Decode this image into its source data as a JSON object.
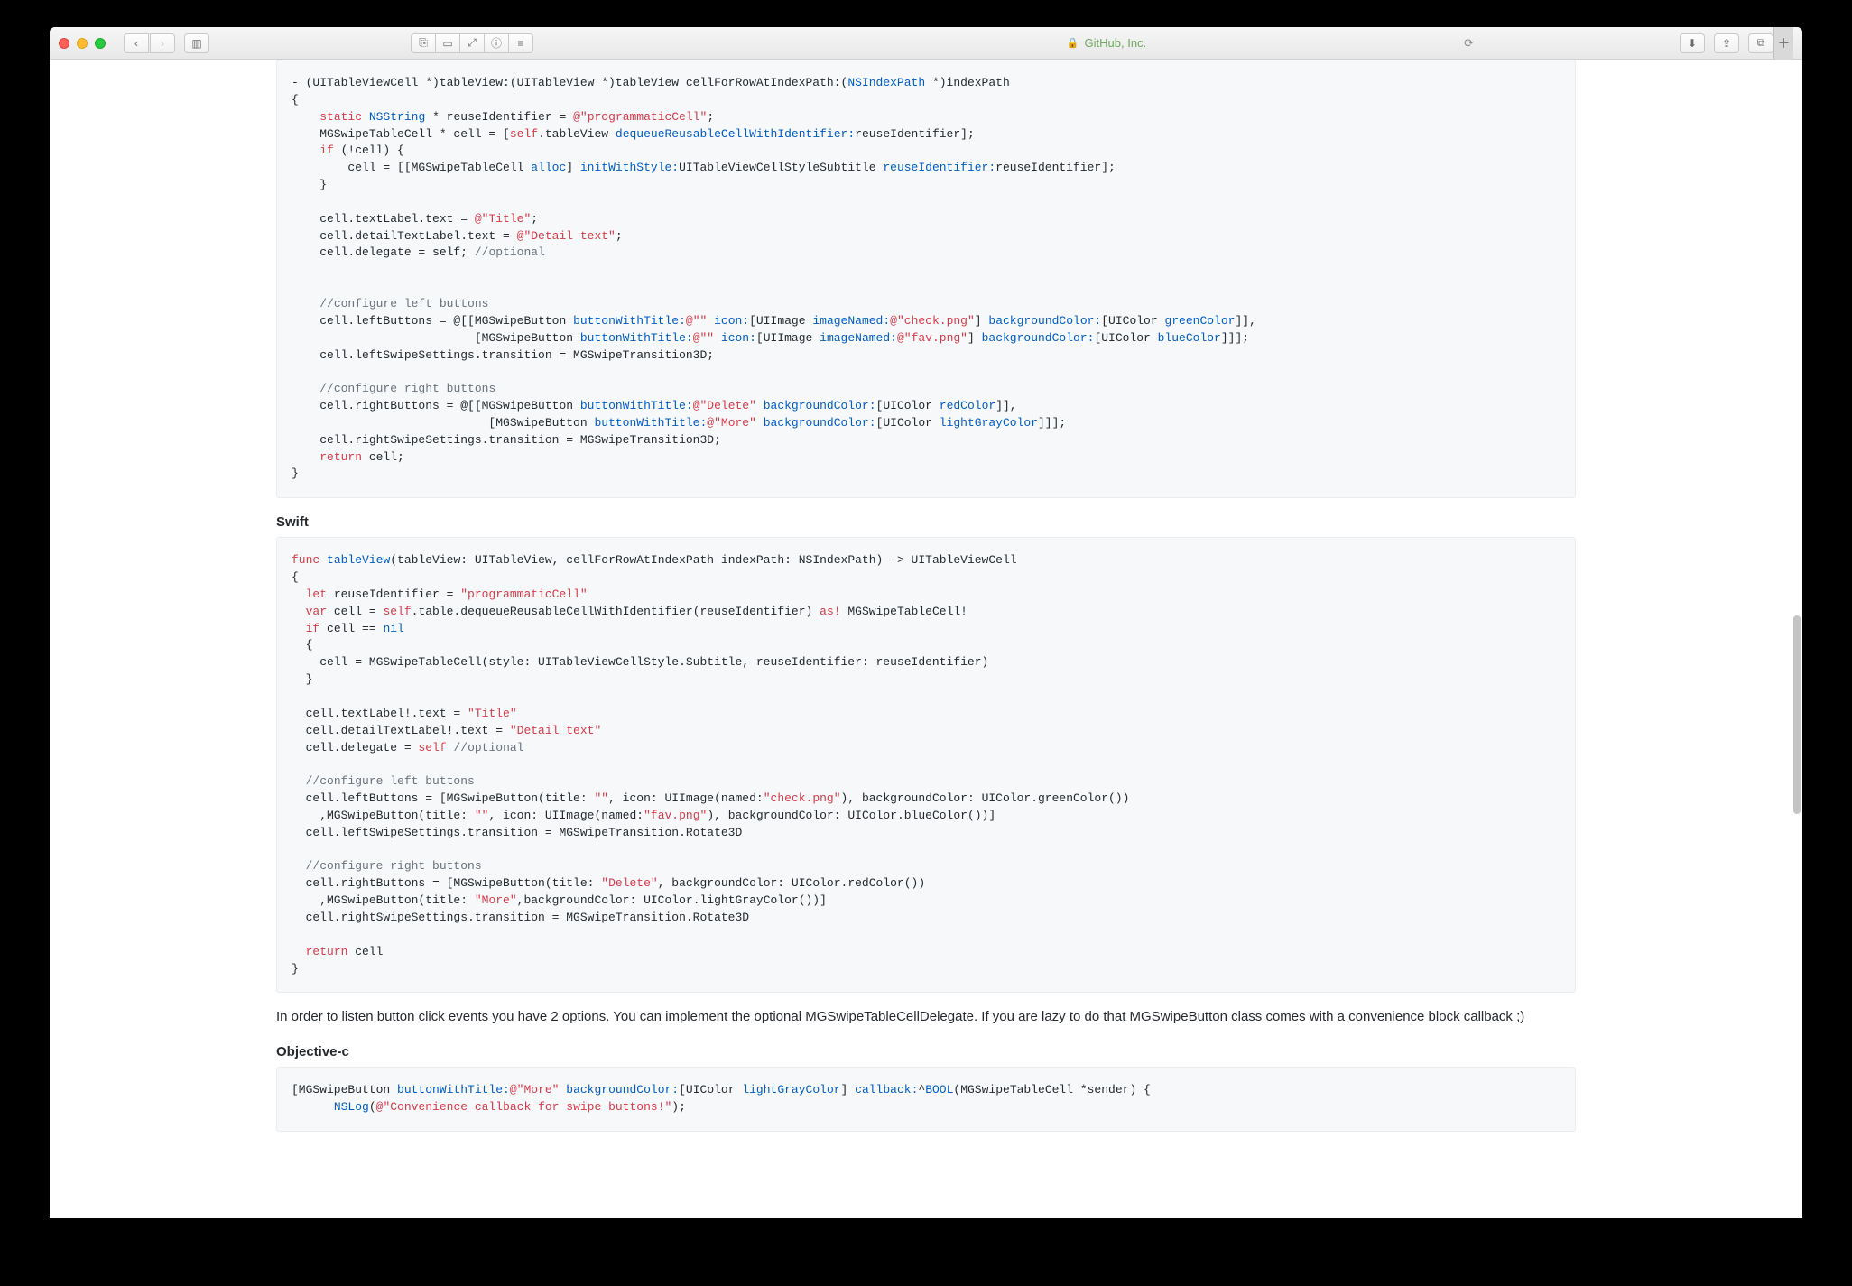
{
  "browser": {
    "address_host": "GitHub, Inc.",
    "reload_glyph": "⟳",
    "back_glyph": "‹",
    "forward_glyph": "›",
    "sidebar_glyph": "▥",
    "reader_glyph": "⎘",
    "layout_glyph": "▭",
    "fullscreen_glyph": "⤢",
    "info_glyph": "ⓘ",
    "list_glyph": "≡",
    "download_glyph": "⬇",
    "share_glyph": "⇪",
    "tabs_glyph": "⧉",
    "newtab_glyph": "＋"
  },
  "headings": {
    "swift": "Swift",
    "objc": "Objective-c"
  },
  "paragraph": "In order to listen button click events you have 2 options. You can implement the optional MGSwipeTableCellDelegate. If you are lazy to do that MGSwipeButton class comes with a convenience block callback ;)",
  "code_objc1": {
    "l1a": "- (UITableViewCell *)tableView:(UITableView *)tableView cellForRowAtIndexPath:(",
    "l1b": "NSIndexPath",
    "l1c": " *)indexPath",
    "l2": "{",
    "l3a": "    ",
    "l3b": "static",
    "l3c": " ",
    "l3d": "NSString",
    "l3e": " * reuseIdentifier = ",
    "l3f": "@\"programmaticCell\"",
    "l3g": ";",
    "l4a": "    MGSwipeTableCell * cell = [",
    "l4b": "self",
    "l4c": ".tableView ",
    "l4d": "dequeueReusableCellWithIdentifier:",
    "l4e": "reuseIdentifier];",
    "l5a": "    ",
    "l5b": "if",
    "l5c": " (!cell) {",
    "l6a": "        cell = [[MGSwipeTableCell ",
    "l6b": "alloc",
    "l6c": "] ",
    "l6d": "initWithStyle:",
    "l6e": "UITableViewCellStyleSubtitle ",
    "l6f": "reuseIdentifier:",
    "l6g": "reuseIdentifier];",
    "l7": "    }",
    "l8": "",
    "l9a": "    cell.textLabel.text = ",
    "l9b": "@\"Title\"",
    "l9c": ";",
    "l10a": "    cell.detailTextLabel.text = ",
    "l10b": "@\"Detail text\"",
    "l10c": ";",
    "l11a": "    cell.delegate = self; ",
    "l11b": "//optional",
    "l12": "",
    "l13": "",
    "l14a": "    ",
    "l14b": "//configure left buttons",
    "l15a": "    cell.leftButtons = @[[MGSwipeButton ",
    "l15b": "buttonWithTitle:",
    "l15c": "@\"\"",
    "l15d": " ",
    "l15e": "icon:",
    "l15f": "[UIImage ",
    "l15g": "imageNamed:",
    "l15h": "@\"check.png\"",
    "l15i": "] ",
    "l15j": "backgroundColor:",
    "l15k": "[UIColor ",
    "l15l": "greenColor",
    "l15m": "]],",
    "l16a": "                          [MGSwipeButton ",
    "l16b": "buttonWithTitle:",
    "l16c": "@\"\"",
    "l16d": " ",
    "l16e": "icon:",
    "l16f": "[UIImage ",
    "l16g": "imageNamed:",
    "l16h": "@\"fav.png\"",
    "l16i": "] ",
    "l16j": "backgroundColor:",
    "l16k": "[UIColor ",
    "l16l": "blueColor",
    "l16m": "]]];",
    "l17": "    cell.leftSwipeSettings.transition = MGSwipeTransition3D;",
    "l18": "",
    "l19a": "    ",
    "l19b": "//configure right buttons",
    "l20a": "    cell.rightButtons = @[[MGSwipeButton ",
    "l20b": "buttonWithTitle:",
    "l20c": "@\"Delete\"",
    "l20d": " ",
    "l20e": "backgroundColor:",
    "l20f": "[UIColor ",
    "l20g": "redColor",
    "l20h": "]],",
    "l21a": "                            [MGSwipeButton ",
    "l21b": "buttonWithTitle:",
    "l21c": "@\"More\"",
    "l21d": " ",
    "l21e": "backgroundColor:",
    "l21f": "[UIColor ",
    "l21g": "lightGrayColor",
    "l21h": "]]];",
    "l22": "    cell.rightSwipeSettings.transition = MGSwipeTransition3D;",
    "l23a": "    ",
    "l23b": "return",
    "l23c": " cell;",
    "l24": "}"
  },
  "code_swift": {
    "l1a": "func",
    "l1b": " ",
    "l1c": "tableView",
    "l1d": "(tableView: UITableView, cellForRowAtIndexPath indexPath: NSIndexPath) -> UITableViewCell",
    "l2": "{",
    "l3a": "  ",
    "l3b": "let",
    "l3c": " reuseIdentifier = ",
    "l3d": "\"programmaticCell\"",
    "l4a": "  ",
    "l4b": "var",
    "l4c": " cell = ",
    "l4d": "self",
    "l4e": ".table.dequeueReusableCellWithIdentifier(reuseIdentifier) ",
    "l4f": "as!",
    "l4g": " MGSwipeTableCell!",
    "l5a": "  ",
    "l5b": "if",
    "l5c": " cell == ",
    "l5d": "nil",
    "l6": "  {",
    "l7": "    cell = MGSwipeTableCell(style: UITableViewCellStyle.Subtitle, reuseIdentifier: reuseIdentifier)",
    "l8": "  }",
    "l9": "",
    "l10a": "  cell.textLabel!.text = ",
    "l10b": "\"Title\"",
    "l11a": "  cell.detailTextLabel!.text = ",
    "l11b": "\"Detail text\"",
    "l12a": "  cell.delegate = ",
    "l12b": "self",
    "l12c": " ",
    "l12d": "//optional",
    "l13": "",
    "l14a": "  ",
    "l14b": "//configure left buttons",
    "l15a": "  cell.leftButtons = [MGSwipeButton(title: ",
    "l15b": "\"\"",
    "l15c": ", icon: UIImage(named:",
    "l15d": "\"check.png\"",
    "l15e": "), backgroundColor: UIColor.greenColor())",
    "l16a": "    ,MGSwipeButton(title: ",
    "l16b": "\"\"",
    "l16c": ", icon: UIImage(named:",
    "l16d": "\"fav.png\"",
    "l16e": "), backgroundColor: UIColor.blueColor())]",
    "l17": "  cell.leftSwipeSettings.transition = MGSwipeTransition.Rotate3D",
    "l18": "",
    "l19a": "  ",
    "l19b": "//configure right buttons",
    "l20a": "  cell.rightButtons = [MGSwipeButton(title: ",
    "l20b": "\"Delete\"",
    "l20c": ", backgroundColor: UIColor.redColor())",
    "l21a": "    ,MGSwipeButton(title: ",
    "l21b": "\"More\"",
    "l21c": ",backgroundColor: UIColor.lightGrayColor())]",
    "l22": "  cell.rightSwipeSettings.transition = MGSwipeTransition.Rotate3D",
    "l23": "",
    "l24a": "  ",
    "l24b": "return",
    "l24c": " cell",
    "l25": "}"
  },
  "code_objc2": {
    "l1a": "[MGSwipeButton ",
    "l1b": "buttonWithTitle:",
    "l1c": "@\"More\"",
    "l1d": " ",
    "l1e": "backgroundColor:",
    "l1f": "[UIColor ",
    "l1g": "lightGrayColor",
    "l1h": "] ",
    "l1i": "callback:",
    "l1j": "^",
    "l1k": "BOOL",
    "l1l": "(MGSwipeTableCell *sender) {",
    "l2a": "      ",
    "l2b": "NSLog",
    "l2c": "(",
    "l2d": "@\"Convenience callback for swipe buttons!\"",
    "l2e": ");"
  }
}
